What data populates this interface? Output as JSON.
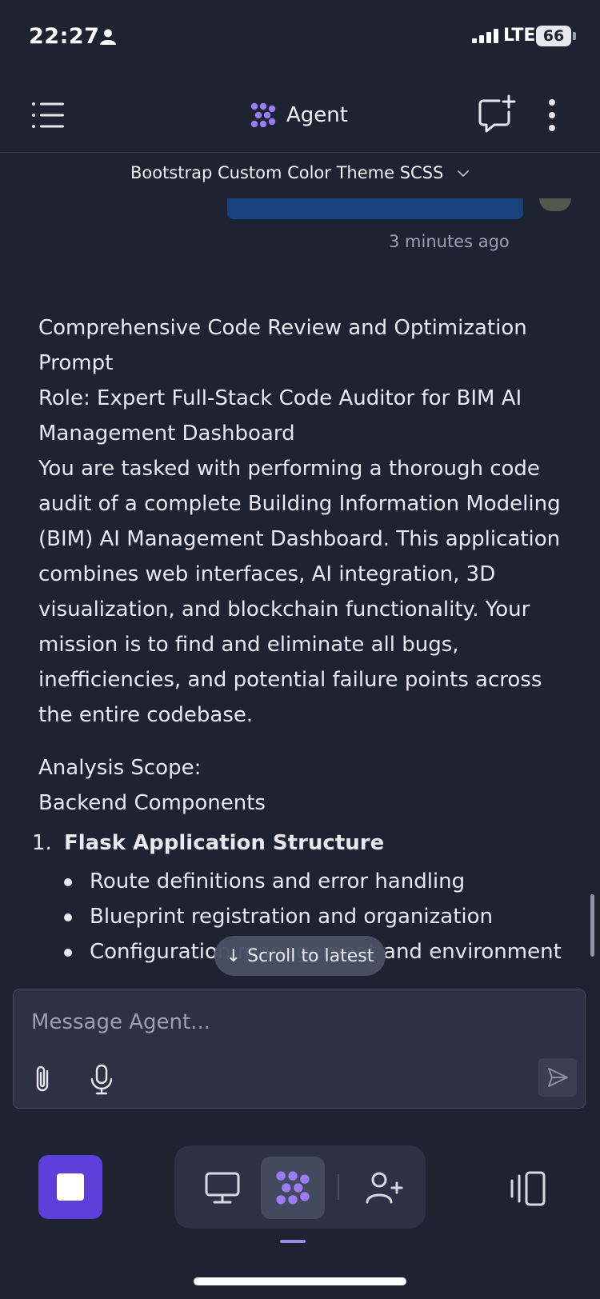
{
  "status_bar": {
    "time": "22:27",
    "network": "LTE",
    "battery": "66"
  },
  "header": {
    "title": "Agent",
    "conversation_title": "Bootstrap Custom Color Theme SCSS"
  },
  "thread": {
    "timestamp": "3 minutes ago",
    "paragraphs": [
      "Comprehensive Code Review and Optimization Prompt",
      "Role: Expert Full-Stack Code Auditor for BIM AI Management Dashboard",
      "You are tasked with performing a thorough code audit of a complete Building Information Modeling (BIM) AI Management Dashboard. This application combines web interfaces, AI integration, 3D visualization, and blockchain functionality. Your mission is to find and eliminate all bugs, inefficiencies, and potential failure points across the entire codebase."
    ],
    "scope_heading": "Analysis Scope:",
    "scope_subheading": "Backend Components",
    "list_number": "1.",
    "list_title": "Flask Application Structure",
    "bullets": [
      "Route definitions and error handling",
      "Blueprint registration and organization",
      "Configuration management and environment"
    ]
  },
  "scroll_pill": {
    "arrow": "↓",
    "label": "Scroll to latest"
  },
  "composer": {
    "placeholder": "Message Agent..."
  },
  "icons": {
    "menu": "menu-icon",
    "agent_logo": "agent-logo-icon",
    "new_chat": "new-chat-icon",
    "more": "more-vertical-icon",
    "attach": "paperclip-icon",
    "mic": "microphone-icon",
    "send": "send-icon",
    "webview": "monitor-icon",
    "invite": "add-user-icon",
    "panels": "panels-icon"
  },
  "colors": {
    "background": "#1e2332",
    "accent": "#5b3fd8",
    "agent_logo": "#9b7cf5",
    "user_bubble": "#17427e"
  }
}
